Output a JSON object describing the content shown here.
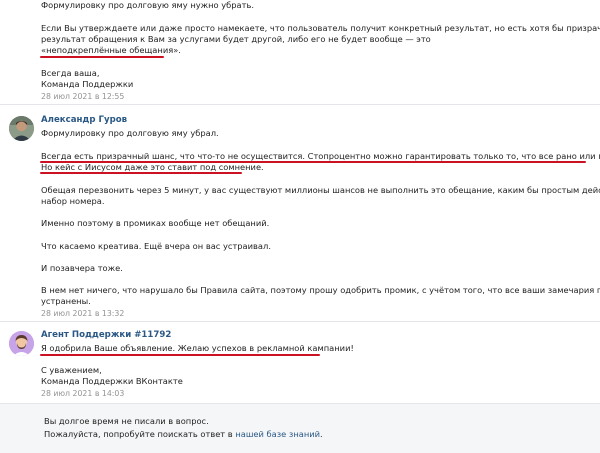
{
  "messages": [
    {
      "lines": [
        "Формулировку про долговую яму нужно убрать.",
        "Если Вы утверждаете или даже просто намекаете, что пользователь получит конкретный результат, но есть хотя бы призрачный шанс, что",
        "результат обращения к Вам за услугами будет другой, либо его не будет вообще — это",
        "«неподкреплённые обещания».",
        "Всегда ваша,",
        "Команда Поддержки"
      ],
      "date": "28 июл 2021 в 12:55"
    },
    {
      "author": "Александр Гуров",
      "lines": [
        "Формулировку про долговую яму убрал.",
        "Всегда есть призрачный шанс, что что-то не осуществится. Стопроцентно можно гарантировать только то, что все рано или поздно умрем.",
        "Но кейс с Иисусом даже это ставит под сомнение.",
        "Обещая перезвонить через 5 минут, у вас существуют миллионы шансов не выполнить это обещание, каким бы простым действием ни был",
        "набор номера.",
        "Именно поэтому в промиках вообще нет обещаний.",
        "Что касаемо креатива. Ещё вчера он вас устраивал.",
        "И позавчера тоже.",
        "В нем нет ничего, что нарушало бы Правила сайта, поэтому прошу одобрить промик, с учётом того, что все ваши замечария по тексту",
        "устранены."
      ],
      "date": "28 июл 2021 в 13:32"
    },
    {
      "author": "Агент Поддержки #11792",
      "lines": [
        "Я одобрила Ваше объявление. Желаю успехов в рекламной кампании!",
        "С уважением,",
        "Команда Поддержки ВКонтакте"
      ],
      "date": "28 июл 2021 в 14:03"
    }
  ],
  "footer": {
    "line1": "Вы долгое время не писали в вопрос.",
    "line2_prefix": "Пожалуйста, попробуйте поискать ответ в ",
    "line2_link": "нашей базе знаний",
    "line2_suffix": "."
  },
  "colors": {
    "link": "#2a5885",
    "underline": "#cc1122",
    "date": "#939393"
  }
}
